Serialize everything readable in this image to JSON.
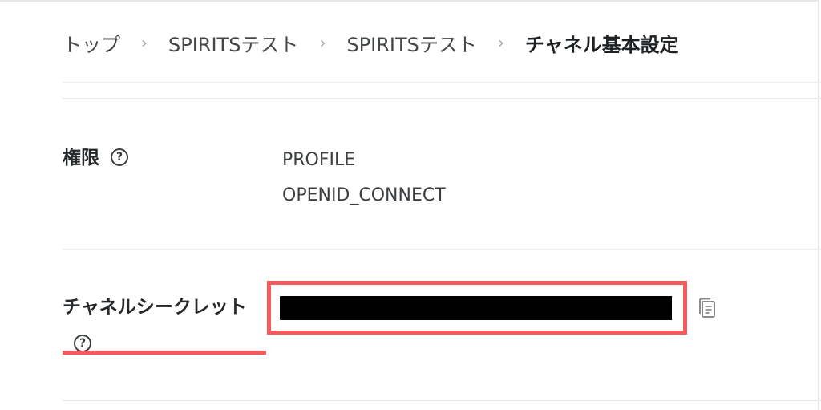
{
  "breadcrumb": {
    "items": [
      "トップ",
      "SPIRITSテスト",
      "SPIRITSテスト"
    ],
    "separator": "›",
    "current": "チャネル基本設定"
  },
  "permissions": {
    "label": "権限",
    "help_icon": "question-circle-icon",
    "help_glyph": "?",
    "values": [
      "PROFILE",
      "OPENID_CONNECT"
    ]
  },
  "channel_secret": {
    "label": "チャネルシークレット",
    "help_icon": "question-circle-icon",
    "help_glyph": "?",
    "value_masked": true,
    "copy_icon": "copy-icon"
  },
  "colors": {
    "highlight": "#f55a5f",
    "mask": "#000000",
    "divider": "#ececee"
  }
}
